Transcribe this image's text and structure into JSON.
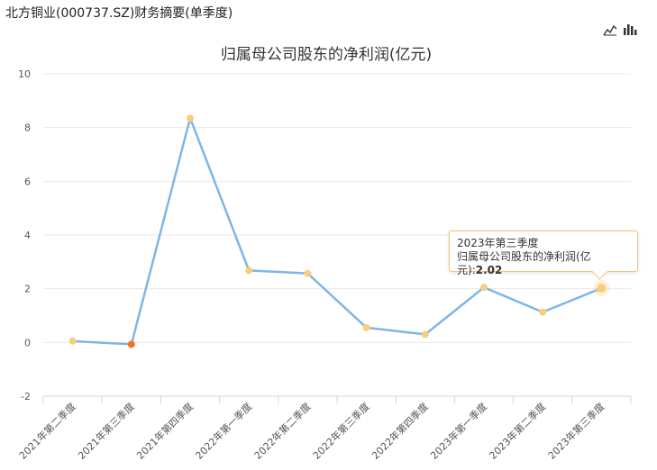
{
  "header": {
    "title": "北方铜业(000737.SZ)财务摘要(单季度)"
  },
  "toolbar": {
    "line_icon": "line-chart-icon",
    "bar_icon": "bar-chart-icon"
  },
  "tooltip": {
    "period": "2023年第三季度",
    "label": "归属母公司股东的净利润(亿元):",
    "value": "2.02"
  },
  "colors": {
    "line": "#7eb6e6",
    "point": "#f7cf7a",
    "negative_point": "#f5731d",
    "grid": "#e8e8e8"
  },
  "chart_data": {
    "type": "line",
    "title": "归属母公司股东的净利润(亿元)",
    "categories": [
      "2021年第二季度",
      "2021年第三季度",
      "2021年第四季度",
      "2022年第一季度",
      "2022年第二季度",
      "2022年第三季度",
      "2022年第四季度",
      "2023年第一季度",
      "2023年第二季度",
      "2023年第三季度"
    ],
    "series": [
      {
        "values": [
          0.05,
          -0.07,
          8.35,
          2.68,
          2.57,
          0.55,
          0.3,
          2.05,
          1.13,
          2.02
        ]
      }
    ],
    "ylim": [
      -2,
      10
    ],
    "yticks": [
      -2,
      0,
      2,
      4,
      6,
      8,
      10
    ],
    "grid": true,
    "highlight_index": 9
  }
}
